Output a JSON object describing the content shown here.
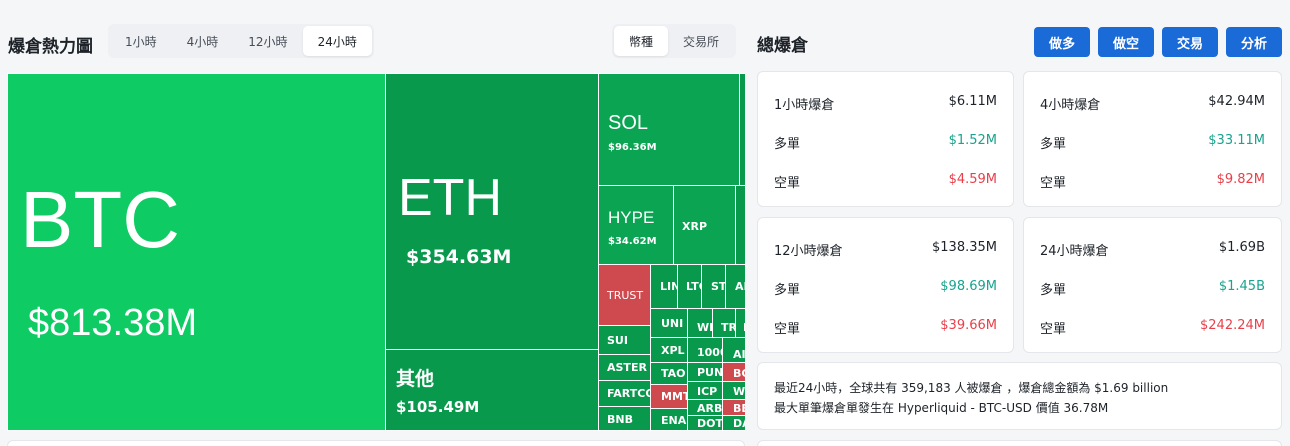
{
  "header": {
    "title": "爆倉熱力圖",
    "time_tabs": [
      "1小時",
      "4小時",
      "12小時",
      "24小時"
    ],
    "active_time": "24小時",
    "view_tabs": [
      "幣種",
      "交易所"
    ],
    "active_view": "幣種"
  },
  "treemap": {
    "btc": {
      "symbol": "BTC",
      "value": "$813.38M"
    },
    "eth": {
      "symbol": "ETH",
      "value": "$354.63M"
    },
    "other": {
      "symbol": "其他",
      "value": "$105.49M"
    },
    "sol": {
      "symbol": "SOL",
      "value": "$96.36M"
    },
    "hype": {
      "symbol": "HYPE",
      "value": "$34.62M"
    },
    "xrp": {
      "symbol": "XRP"
    },
    "trust": {
      "symbol": "TRUST"
    },
    "sui": {
      "symbol": "SUI"
    },
    "aster": {
      "symbol": "ASTER"
    },
    "fartco": {
      "symbol": "FARTCO"
    },
    "bnb": {
      "symbol": "BNB"
    },
    "lin": {
      "symbol": "LIN"
    },
    "ltc": {
      "symbol": "LTC"
    },
    "st": {
      "symbol": "ST"
    },
    "ad": {
      "symbol": "AD"
    },
    "uni": {
      "symbol": "UNI"
    },
    "wl": {
      "symbol": "WI"
    },
    "tr": {
      "symbol": "TR"
    },
    "m": {
      "symbol": "M"
    },
    "xpl": {
      "symbol": "XPL"
    },
    "k1000": {
      "symbol": "1000"
    },
    "ai": {
      "symbol": "AI"
    },
    "tao": {
      "symbol": "TAO"
    },
    "pun": {
      "symbol": "PUN"
    },
    "bch": {
      "symbol": "BCH"
    },
    "mmt": {
      "symbol": "MMT"
    },
    "icp": {
      "symbol": "ICP"
    },
    "wl2": {
      "symbol": "WL"
    },
    "arb": {
      "symbol": "ARB"
    },
    "bea": {
      "symbol": "BEA"
    },
    "ena": {
      "symbol": "ENA"
    },
    "dot": {
      "symbol": "DOT"
    },
    "das": {
      "symbol": "DAS"
    }
  },
  "total": {
    "title": "總爆倉",
    "actions": [
      "做多",
      "做空",
      "交易",
      "分析"
    ],
    "long_label": "多單",
    "short_label": "空單",
    "cards": [
      {
        "label": "1小時爆倉",
        "total": "$6.11M",
        "long": "$1.52M",
        "short": "$4.59M"
      },
      {
        "label": "4小時爆倉",
        "total": "$42.94M",
        "long": "$33.11M",
        "short": "$9.82M"
      },
      {
        "label": "12小時爆倉",
        "total": "$138.35M",
        "long": "$98.69M",
        "short": "$39.66M"
      },
      {
        "label": "24小時爆倉",
        "total": "$1.69B",
        "long": "$1.45B",
        "short": "$242.24M"
      }
    ],
    "summary_line1": "最近24小時，全球共有 359,183 人被爆倉 ，爆倉總金額為 $1.69 billion",
    "summary_line2": "最大單筆爆倉單發生在 Hyperliquid - BTC-USD 價值 36.78M"
  },
  "colors": {
    "accent": "#1a6ad8",
    "long": "#1aa38f",
    "short": "#e8404a",
    "gain": "#0ecb64",
    "loss": "#cf4a4f"
  }
}
